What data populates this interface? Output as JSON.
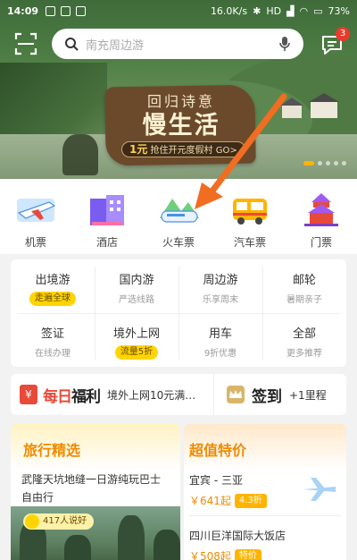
{
  "status_bar": {
    "time": "14:09",
    "net_speed": "16.0K/s",
    "network": "HD",
    "battery": "73%"
  },
  "header": {
    "search_placeholder": "南充周边游",
    "message_badge": "3"
  },
  "banner": {
    "line1": "回归诗意",
    "line2": "慢生活",
    "cta_amount": "1元",
    "cta_text": "抢住开元度假村 GO>"
  },
  "categories": [
    {
      "label": "机票",
      "icon": "plane-ticket-icon"
    },
    {
      "label": "酒店",
      "icon": "hotel-icon"
    },
    {
      "label": "火车票",
      "icon": "train-icon"
    },
    {
      "label": "汽车票",
      "icon": "bus-icon"
    },
    {
      "label": "门票",
      "icon": "temple-ticket-icon"
    }
  ],
  "grid": [
    {
      "title": "出境游",
      "sub": "走遍全球",
      "pill": true
    },
    {
      "title": "国内游",
      "sub": "严选线路",
      "pill": false
    },
    {
      "title": "周边游",
      "sub": "乐享周末",
      "pill": false
    },
    {
      "title": "邮轮",
      "sub": "暑期亲子",
      "pill": false
    },
    {
      "title": "签证",
      "sub": "在线办理",
      "pill": false
    },
    {
      "title": "境外上网",
      "sub": "流量5折",
      "pill": true
    },
    {
      "title": "用车",
      "sub": "9折优惠",
      "pill": false
    },
    {
      "title": "全部",
      "sub": "更多推荐",
      "pill": false
    }
  ],
  "promo": {
    "fuli_prefix": "每日",
    "fuli_suffix": "福利",
    "fuli_text": "境外上网10元满…",
    "checkin": "签到",
    "checkin_text": "+1里程"
  },
  "recommend": {
    "title": "旅行精选",
    "desc": "武隆天坑地缝一日游纯玩巴士自由行",
    "likes": "417人说好"
  },
  "deals": {
    "title": "超值特价",
    "items": [
      {
        "name": "宜宾 - 三亚",
        "price": "￥641起",
        "tag": "4.3折"
      },
      {
        "name": "四川巨洋国际大饭店",
        "price": "￥508起",
        "tag": "特价"
      }
    ]
  },
  "colors": {
    "accent": "#f08a00",
    "pill": "#ffd400",
    "badge": "#e83b2e",
    "arrow": "#f06d21"
  }
}
